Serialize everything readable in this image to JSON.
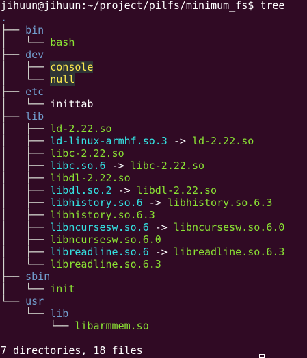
{
  "terminal": {
    "prompt_text": "jihuun@jihuun:~/project/pilfs/minimum_fs$ tree",
    "root": ".",
    "entries": {
      "bin": "bin",
      "bash": "bash",
      "dev": "dev",
      "console": "console",
      "null": "null",
      "etc": "etc",
      "inittab": "inittab",
      "lib": "lib",
      "ld222": "ld-2.22.so",
      "ld_linux": "ld-linux-armhf.so.3",
      "ld_linux_target": "ld-2.22.so",
      "libc222": "libc-2.22.so",
      "libc_so6": "libc.so.6",
      "libc_so6_target": "libc-2.22.so",
      "libdl222": "libdl-2.22.so",
      "libdl_so2": "libdl.so.2",
      "libdl_so2_target": "libdl-2.22.so",
      "libhistory_so6": "libhistory.so.6",
      "libhistory_so6_target": "libhistory.so.6.3",
      "libhistory_so63": "libhistory.so.6.3",
      "libncursesw_so6": "libncursesw.so.6",
      "libncursesw_so6_target": "libncursesw.so.6.0",
      "libncursesw_so60": "libncursesw.so.6.0",
      "libreadline_so6": "libreadline.so.6",
      "libreadline_so6_target": "libreadline.so.6.3",
      "libreadline_so63": "libreadline.so.6.3",
      "sbin": "sbin",
      "init": "init",
      "usr": "usr",
      "usr_lib": "lib",
      "libarmmem": "libarmmem.so"
    },
    "arrow": "->",
    "summary": "7 directories, 18 files"
  },
  "colors": {
    "background": "#300a24",
    "directory": "#729fcf",
    "executable": "#8ae234",
    "symlink": "#34e2e2",
    "device_fg": "#fce94f",
    "device_bg": "#2e3436"
  }
}
